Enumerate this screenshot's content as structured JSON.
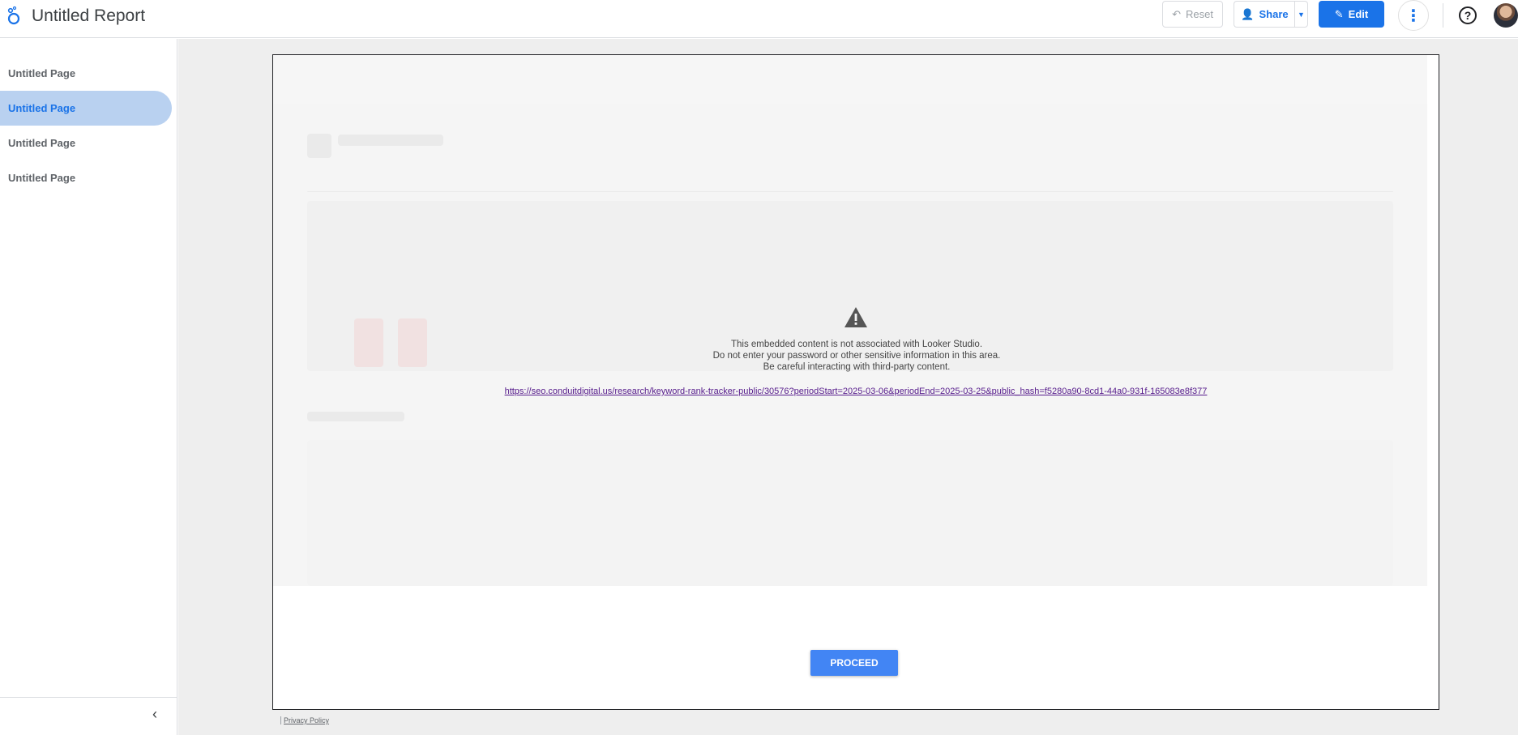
{
  "header": {
    "title": "Untitled Report",
    "reset_label": "Reset",
    "share_label": "Share",
    "edit_label": "Edit",
    "help_label": "?"
  },
  "sidebar": {
    "items": [
      {
        "label": "Untitled Page",
        "active": false
      },
      {
        "label": "Untitled Page",
        "active": true
      },
      {
        "label": "Untitled Page",
        "active": false
      },
      {
        "label": "Untitled Page",
        "active": false
      }
    ],
    "collapse_icon": "chevron-left-icon"
  },
  "embed": {
    "notice_line1": "This embedded content is not associated with Looker Studio.",
    "notice_line2": "Do not enter your password or other sensitive information in this area.",
    "notice_line3": "Be careful interacting with third-party content.",
    "url": "https://seo.conduitdigital.us/research/keyword-rank-tracker-public/30576?periodStart=2025-03-06&periodEnd=2025-03-25&public_hash=f5280a90-8cd1-44a0-931f-165083e8f377",
    "proceed_label": "PROCEED"
  },
  "footer": {
    "privacy_label": "Privacy Policy"
  },
  "colors": {
    "accent": "#1a73e8",
    "active_page_bg": "#b9d1f0",
    "proceed_bg": "#4285f4"
  }
}
